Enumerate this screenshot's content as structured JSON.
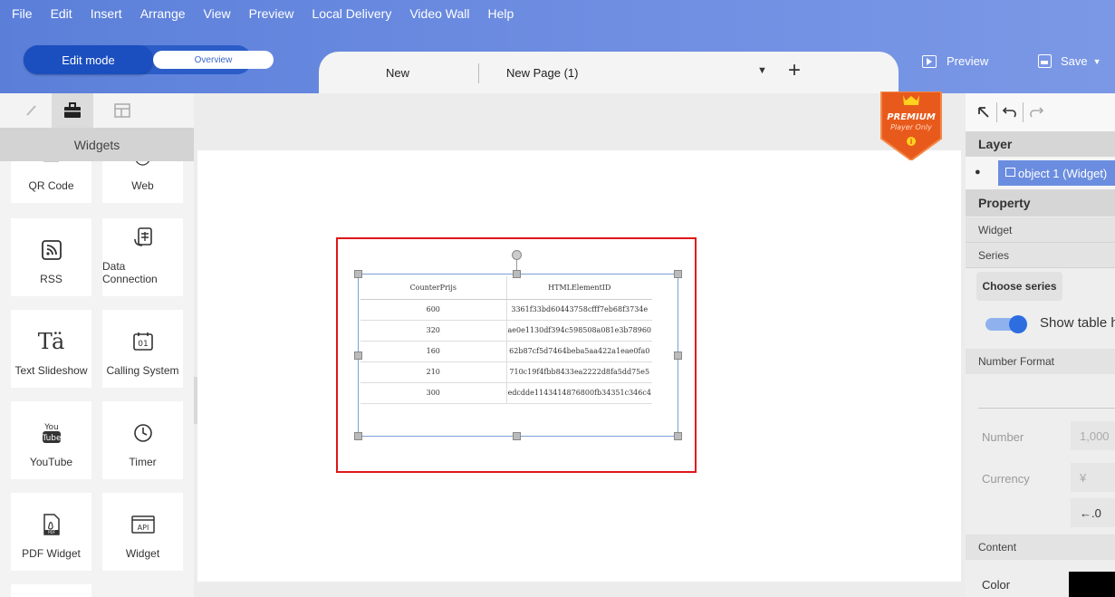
{
  "menu": [
    "File",
    "Edit",
    "Insert",
    "Arrange",
    "View",
    "Preview",
    "Local Delivery",
    "Video Wall",
    "Help"
  ],
  "mode": {
    "edit": "Edit mode",
    "overview": "Overview"
  },
  "tabs": {
    "new": "New",
    "page": "New Page (1)"
  },
  "actions": {
    "preview": "Preview",
    "save": "Save"
  },
  "left": {
    "title": "Widgets",
    "widgets": [
      {
        "label": "QR Code",
        "icon": "qr-code-icon"
      },
      {
        "label": "Web",
        "icon": "web-icon"
      },
      {
        "label": "RSS",
        "icon": "rss-icon"
      },
      {
        "label": "Data Connection",
        "icon": "data-connection-icon"
      },
      {
        "label": "Text Slideshow",
        "icon": "text-slideshow-icon"
      },
      {
        "label": "Calling System",
        "icon": "calling-system-icon"
      },
      {
        "label": "YouTube",
        "icon": "youtube-icon"
      },
      {
        "label": "Timer",
        "icon": "timer-icon"
      },
      {
        "label": "PDF Widget",
        "icon": "pdf-icon"
      },
      {
        "label": "Widget",
        "icon": "api-icon"
      }
    ]
  },
  "premium": {
    "line1": "PREMIUM",
    "line2": "Player Only"
  },
  "table": {
    "headers": [
      "CounterPrijs",
      "HTMLElementID"
    ],
    "rows": [
      [
        "600",
        "3361f33bd60443758cfff7eb68f3734e"
      ],
      [
        "320",
        "ae0e1130df394c598508a081e3b78960"
      ],
      [
        "160",
        "62b87cf5d7464beba5aa422a1eae0fa0"
      ],
      [
        "210",
        "710c19f4fbb8433ea2222d8fa5dd75e5"
      ],
      [
        "300",
        "edcdde1143414876800fb34351c346c4"
      ]
    ]
  },
  "right": {
    "layer": "Layer",
    "object": "object 1 (Widget)",
    "property": "Property",
    "widget": "Widget",
    "series": "Series",
    "choose_series": "Choose series",
    "show_table_header": "Show table header",
    "number_format": "Number Format",
    "number_label": "Number",
    "number_value": "1,000",
    "currency_label": "Currency",
    "currency_value": "¥",
    "decimal_value": "←.0",
    "content": "Content",
    "color": "Color"
  },
  "colors": {
    "header": "#6f8ee2",
    "accent": "#2d6de0",
    "selection_red": "#e0161a",
    "premium": "#e85a1c"
  }
}
